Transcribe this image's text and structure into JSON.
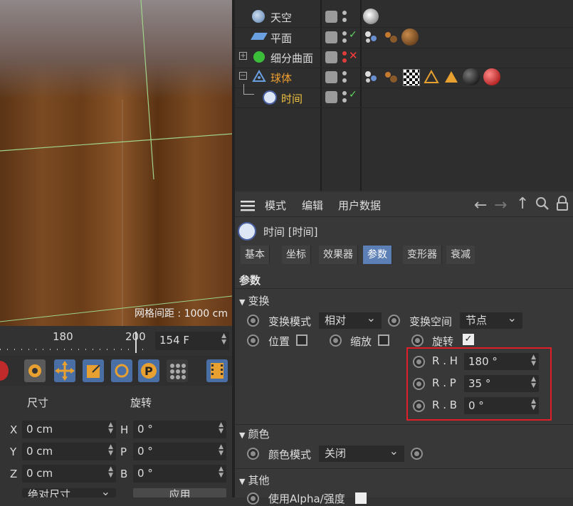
{
  "viewport": {
    "grid_label": "网格间距 : 1000 cm"
  },
  "objects": [
    {
      "name": "天空",
      "color": "#dddddd",
      "tags": [
        "sky-texture"
      ]
    },
    {
      "name": "平面",
      "color": "#dddddd",
      "tags": [
        "dots",
        "spheres",
        "wood"
      ]
    },
    {
      "name": "细分曲面",
      "color": "#dddddd",
      "tags": []
    },
    {
      "name": "球体",
      "color": "#f0a030",
      "tags": [
        "dots",
        "spheres",
        "checker",
        "triangle-outline",
        "triangle-filled",
        "black-ball",
        "red-ball"
      ]
    },
    {
      "name": "时间",
      "color": "#f0c040",
      "tags": []
    }
  ],
  "attr_menu": {
    "mode": "模式",
    "edit": "编辑",
    "user_data": "用户数据"
  },
  "attr_title": "时间 [时间]",
  "tabs": [
    {
      "label": "基本",
      "active": false
    },
    {
      "label": "坐标",
      "active": false
    },
    {
      "label": "效果器",
      "active": false
    },
    {
      "label": "参数",
      "active": true
    },
    {
      "label": "变形器",
      "active": false
    },
    {
      "label": "衰减",
      "active": false
    }
  ],
  "params_heading": "参数",
  "transform": {
    "section": "变换",
    "mode_label": "变换模式",
    "mode_value": "相对",
    "space_label": "变换空间",
    "space_value": "节点",
    "position_label": "位置",
    "position_checked": false,
    "scale_label": "缩放",
    "scale_checked": false,
    "rotation_label": "旋转",
    "rotation_checked": true,
    "rh_label": "R . H",
    "rh_value": "180 °",
    "rp_label": "R . P",
    "rp_value": "35 °",
    "rb_label": "R . B",
    "rb_value": "0 °"
  },
  "color_section": {
    "section": "颜色",
    "mode_label": "颜色模式",
    "mode_value": "关闭"
  },
  "other_section": {
    "section": "其他",
    "partial": "使用Alpha/强度"
  },
  "timeline": {
    "label_180": "180",
    "label_200": "200",
    "frame_value": "154 F"
  },
  "coords": {
    "size_label": "尺寸",
    "rotation_label": "旋转",
    "x_label": "X",
    "x_value": "0 cm",
    "y_label": "Y",
    "y_value": "0 cm",
    "z_label": "Z",
    "z_value": "0 cm",
    "h_label": "H",
    "h_value": "0 °",
    "p_label": "P",
    "p_value": "0 °",
    "b_label": "B",
    "b_value": "0 °",
    "mode_value": "绝对尺寸",
    "apply_label": "应用"
  },
  "highlight_color": "#e01f2a",
  "accent": "#5c7fb6"
}
